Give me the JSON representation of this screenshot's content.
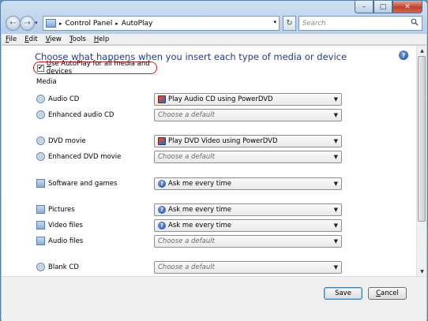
{
  "window": {
    "caption_buttons": {
      "minimize": "–",
      "maximize": "□",
      "close": "✕"
    }
  },
  "address_bar": {
    "path": [
      "Control Panel",
      "AutoPlay"
    ],
    "separator": "▸",
    "dropdown_arrow": "▾",
    "icon": "control-panel-icon"
  },
  "navigation": {
    "back_glyph": "←",
    "forward_glyph": "→",
    "history_glyph": "▾",
    "refresh_glyph": "↻"
  },
  "search": {
    "placeholder": "Search"
  },
  "menu": [
    {
      "key": "F",
      "rest": "ile"
    },
    {
      "key": "E",
      "rest": "dit"
    },
    {
      "key": "V",
      "rest": "iew"
    },
    {
      "key": "T",
      "rest": "ools"
    },
    {
      "key": "H",
      "rest": "elp"
    }
  ],
  "content": {
    "heading": "Choose what happens when you insert each type of media or device",
    "help_glyph": "?",
    "use_autoplay": {
      "label_key": "U",
      "label_rest": "se AutoPlay for all media and devices",
      "checked": true,
      "check_glyph": "✔"
    },
    "group_label": "Media",
    "rows": [
      {
        "label": "Audio CD",
        "icon": "audio-cd-icon",
        "value": "Play Audio CD using PowerDVD",
        "value_icon": "powerdvd-icon",
        "placeholder": false
      },
      {
        "label": "Enhanced audio CD",
        "icon": "enhanced-audio-cd-icon",
        "value": "Choose a default",
        "value_icon": "",
        "placeholder": true
      },
      {
        "label": "DVD movie",
        "icon": "dvd-movie-icon",
        "value": "Play DVD Video using PowerDVD",
        "value_icon": "powerdvd-icon",
        "placeholder": false
      },
      {
        "label": "Enhanced DVD movie",
        "icon": "enhanced-dvd-movie-icon",
        "value": "Choose a default",
        "value_icon": "",
        "placeholder": true
      },
      {
        "label": "Software and games",
        "icon": "software-games-icon",
        "value": "Ask me every time",
        "value_icon": "ask-icon",
        "placeholder": false
      },
      {
        "label": "Pictures",
        "icon": "pictures-icon",
        "value": "Ask me every time",
        "value_icon": "ask-icon",
        "placeholder": false
      },
      {
        "label": "Video files",
        "icon": "video-files-icon",
        "value": "Ask me every time",
        "value_icon": "ask-icon",
        "placeholder": false
      },
      {
        "label": "Audio files",
        "icon": "audio-files-icon",
        "value": "Choose a default",
        "value_icon": "",
        "placeholder": true
      },
      {
        "label": "Blank CD",
        "icon": "blank-cd-icon",
        "value": "Choose a default",
        "value_icon": "",
        "placeholder": true
      },
      {
        "label": "",
        "icon": "partial-disc-icon",
        "value": "",
        "value_icon": "",
        "placeholder": true
      }
    ],
    "dropdown_arrow": "▼"
  },
  "scrollbar": {
    "up_glyph": "▲",
    "down_glyph": "▼"
  },
  "footer": {
    "save": {
      "key": "",
      "label": "Save"
    },
    "cancel": {
      "key": "C",
      "rest": "ancel"
    }
  }
}
